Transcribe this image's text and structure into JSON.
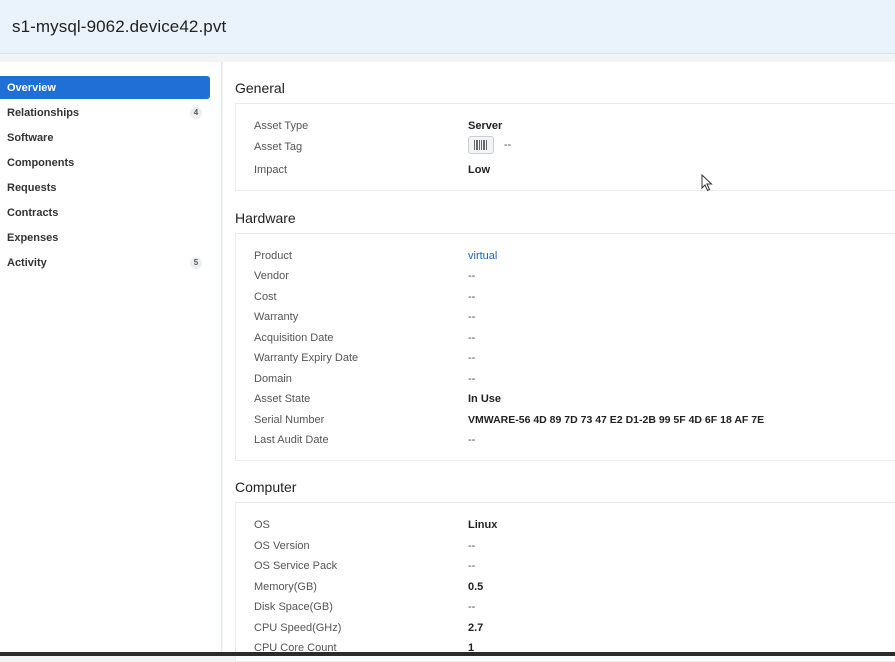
{
  "header": {
    "title": "s1-mysql-9062.device42.pvt"
  },
  "sidebar": {
    "items": [
      {
        "label": "Overview",
        "count": "",
        "active": true
      },
      {
        "label": "Relationships",
        "count": "4",
        "active": false
      },
      {
        "label": "Software",
        "count": "",
        "active": false
      },
      {
        "label": "Components",
        "count": "",
        "active": false
      },
      {
        "label": "Requests",
        "count": "",
        "active": false
      },
      {
        "label": "Contracts",
        "count": "",
        "active": false
      },
      {
        "label": "Expenses",
        "count": "",
        "active": false
      },
      {
        "label": "Activity",
        "count": "5",
        "active": false
      }
    ]
  },
  "sections": {
    "general": {
      "title": "General",
      "rows": [
        {
          "label": "Asset Type",
          "value": "Server"
        },
        {
          "label": "Asset Tag",
          "value": "--"
        },
        {
          "label": "Impact",
          "value": "Low"
        }
      ]
    },
    "hardware": {
      "title": "Hardware",
      "rows": [
        {
          "label": "Product",
          "value": "virtual"
        },
        {
          "label": "Vendor",
          "value": "--"
        },
        {
          "label": "Cost",
          "value": "--"
        },
        {
          "label": "Warranty",
          "value": "--"
        },
        {
          "label": "Acquisition Date",
          "value": "--"
        },
        {
          "label": "Warranty Expiry Date",
          "value": "--"
        },
        {
          "label": "Domain",
          "value": "--"
        },
        {
          "label": "Asset State",
          "value": "In Use"
        },
        {
          "label": "Serial Number",
          "value": "VMWARE-56 4D 89 7D 73 47 E2 D1-2B 99 5F 4D 6F 18 AF 7E"
        },
        {
          "label": "Last Audit Date",
          "value": "--"
        }
      ]
    },
    "computer": {
      "title": "Computer",
      "rows": [
        {
          "label": "OS",
          "value": "Linux"
        },
        {
          "label": "OS Version",
          "value": "--"
        },
        {
          "label": "OS Service Pack",
          "value": "--"
        },
        {
          "label": "Memory(GB)",
          "value": "0.5"
        },
        {
          "label": "Disk Space(GB)",
          "value": "--"
        },
        {
          "label": "CPU Speed(GHz)",
          "value": "2.7"
        },
        {
          "label": "CPU Core Count",
          "value": "1"
        }
      ]
    }
  },
  "icons": {
    "barcode": "barcode-icon",
    "cursor": "mouse-pointer-icon"
  },
  "colors": {
    "accent": "#1f6fd6",
    "link": "#1f5fb8",
    "header_bg": "#eaf3fb"
  }
}
